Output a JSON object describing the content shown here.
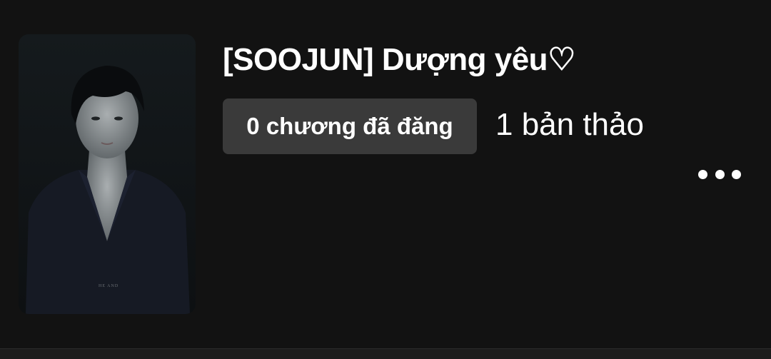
{
  "story": {
    "title": "[SOOJUN] Dượng yêu♡",
    "published_label": "0 chương đã đăng",
    "drafts_label": "1 bản thảo",
    "cover_watermark": "HE AND"
  },
  "icons": {
    "more": "more-horizontal-icon"
  },
  "colors": {
    "background": "#121212",
    "badge_background": "#3a3a3a",
    "text": "#ffffff"
  }
}
